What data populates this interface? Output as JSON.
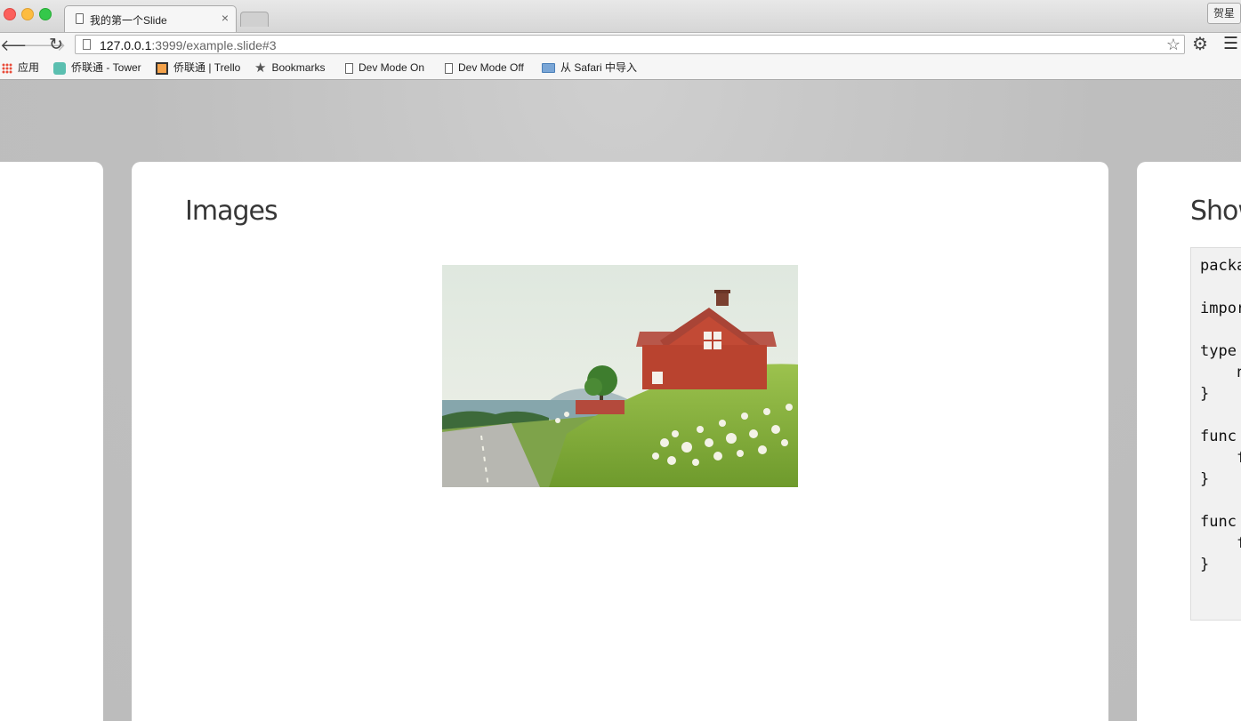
{
  "browser": {
    "tab_title": "我的第一个Slide",
    "tab_close": "×",
    "user_button": "贺星",
    "url_host": "127.0.0.1",
    "url_path": ":3999/example.slide#3",
    "icons": {
      "back": "back-arrow-icon",
      "forward": "forward-arrow-icon",
      "reload": "reload-icon",
      "bookmark_star": "star-icon",
      "settings": "gear-icon",
      "menu": "hamburger-menu-icon"
    }
  },
  "bookmarks": [
    {
      "label": "应用",
      "icon": "apps-grid-icon"
    },
    {
      "label": "侨联通 - Tower",
      "icon": "tower-icon"
    },
    {
      "label": "侨联通 | Trello",
      "icon": "trello-icon"
    },
    {
      "label": "Bookmarks",
      "icon": "star-icon"
    },
    {
      "label": "Dev Mode On",
      "icon": "document-icon"
    },
    {
      "label": "Dev Mode Off",
      "icon": "document-icon"
    },
    {
      "label": "从 Safari 中导入",
      "icon": "folder-icon"
    }
  ],
  "slides": {
    "current": {
      "title": "Images",
      "image_description": "photo"
    },
    "next": {
      "title": "Show",
      "code_lines": [
        "packa",
        "",
        "impor",
        "",
        "type",
        "    n",
        "}",
        "",
        "func",
        "    f",
        "}",
        "",
        "func",
        "    f",
        "}"
      ]
    }
  },
  "colors": {
    "page_background": "#bdbdbd",
    "slide_background": "#ffffff",
    "title_text": "#373737",
    "code_background": "#f1f1f1"
  }
}
